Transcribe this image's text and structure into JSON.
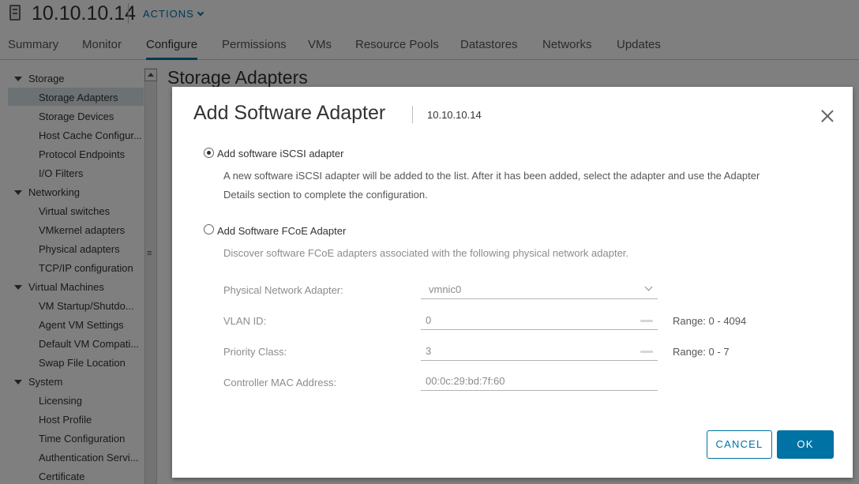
{
  "header": {
    "host": "10.10.10.14",
    "actions_label": "ACTIONS"
  },
  "tabs": [
    {
      "label": "Summary"
    },
    {
      "label": "Monitor"
    },
    {
      "label": "Configure"
    },
    {
      "label": "Permissions"
    },
    {
      "label": "VMs"
    },
    {
      "label": "Resource Pools"
    },
    {
      "label": "Datastores"
    },
    {
      "label": "Networks"
    },
    {
      "label": "Updates"
    }
  ],
  "active_tab": "Configure",
  "sidebar": {
    "groups": [
      {
        "label": "Storage"
      },
      {
        "label": "Networking"
      },
      {
        "label": "Virtual Machines"
      },
      {
        "label": "System"
      }
    ],
    "items": [
      {
        "label": "Storage Adapters"
      },
      {
        "label": "Storage Devices"
      },
      {
        "label": "Host Cache Configur..."
      },
      {
        "label": "Protocol Endpoints"
      },
      {
        "label": "I/O Filters"
      },
      {
        "label": "Virtual switches"
      },
      {
        "label": "VMkernel adapters"
      },
      {
        "label": "Physical adapters"
      },
      {
        "label": "TCP/IP configuration"
      },
      {
        "label": "VM Startup/Shutdo..."
      },
      {
        "label": "Agent VM Settings"
      },
      {
        "label": "Default VM Compati..."
      },
      {
        "label": "Swap File Location"
      },
      {
        "label": "Licensing"
      },
      {
        "label": "Host Profile"
      },
      {
        "label": "Time Configuration"
      },
      {
        "label": "Authentication Servi..."
      },
      {
        "label": "Certificate"
      }
    ],
    "selected": "Storage Adapters"
  },
  "main": {
    "title": "Storage Adapters"
  },
  "modal": {
    "title": "Add Software Adapter",
    "subtitle": "10.10.10.14",
    "option_iscsi": {
      "label": "Add software iSCSI adapter",
      "selected": true,
      "description_line1": "A new software iSCSI adapter will be added to the list. After it has been added, select the adapter and use the Adapter",
      "description_line2": "Details section to complete the configuration."
    },
    "option_fcoe": {
      "label": "Add Software FCoE Adapter",
      "selected": false,
      "description": "Discover software FCoE adapters associated with the following physical network adapter."
    },
    "fields": {
      "physical_adapter_label": "Physical Network Adapter:",
      "physical_adapter_value": "vmnic0",
      "vlan_label": "VLAN ID:",
      "vlan_value": "0",
      "vlan_range": "Range: 0 - 4094",
      "priority_label": "Priority Class:",
      "priority_value": "3",
      "priority_range": "Range: 0 - 7",
      "mac_label": "Controller MAC Address:",
      "mac_value": "00:0c:29:bd:7f:60"
    },
    "cancel_label": "CANCEL",
    "ok_label": "OK"
  },
  "colors": {
    "accent": "#0072a3",
    "overlay": "rgba(0,0,0,0.5)"
  }
}
